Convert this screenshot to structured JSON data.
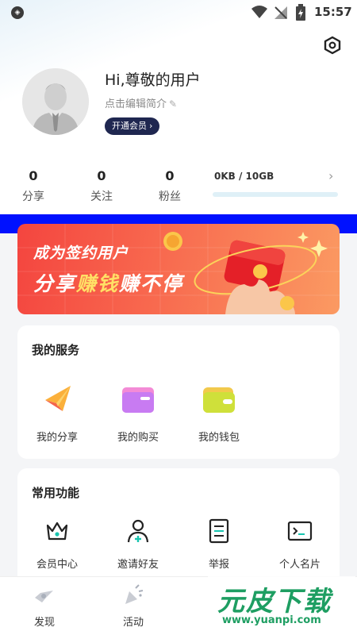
{
  "status_bar": {
    "time": "15:57"
  },
  "profile": {
    "greeting": "Hi,尊敬的用户",
    "edit_bio": "点击编辑简介",
    "vip_label": "开通会员",
    "vip_chevron": "›"
  },
  "stats": [
    {
      "value": "0",
      "label": "分享"
    },
    {
      "value": "0",
      "label": "关注"
    },
    {
      "value": "0",
      "label": "粉丝"
    }
  ],
  "storage": {
    "text": "0KB / 10GB",
    "chevron": "›",
    "used_fraction": 0
  },
  "banner": {
    "line1": "成为签约用户",
    "line2_a": "分享",
    "line2_b": "赚钱",
    "line2_c": "赚不停"
  },
  "services": {
    "title": "我的服务",
    "items": [
      {
        "label": "我的分享",
        "icon": "share-plane-icon"
      },
      {
        "label": "我的购买",
        "icon": "purchase-folder-icon"
      },
      {
        "label": "我的钱包",
        "icon": "wallet-icon"
      }
    ]
  },
  "functions": {
    "title": "常用功能",
    "items": [
      {
        "label": "会员中心",
        "icon": "crown-icon"
      },
      {
        "label": "邀请好友",
        "icon": "add-user-icon"
      },
      {
        "label": "举报",
        "icon": "report-doc-icon"
      },
      {
        "label": "个人名片",
        "icon": "terminal-card-icon"
      }
    ]
  },
  "tabbar": [
    {
      "label": "发现",
      "icon": "discover-icon"
    },
    {
      "label": "活动",
      "icon": "party-icon"
    }
  ],
  "watermark": {
    "logo": "元皮下载",
    "url": "www.yuanpi.com"
  },
  "colors": {
    "accent": "#1f2750",
    "banner_red": "#f4453f",
    "progress": "#2ea7e0"
  }
}
